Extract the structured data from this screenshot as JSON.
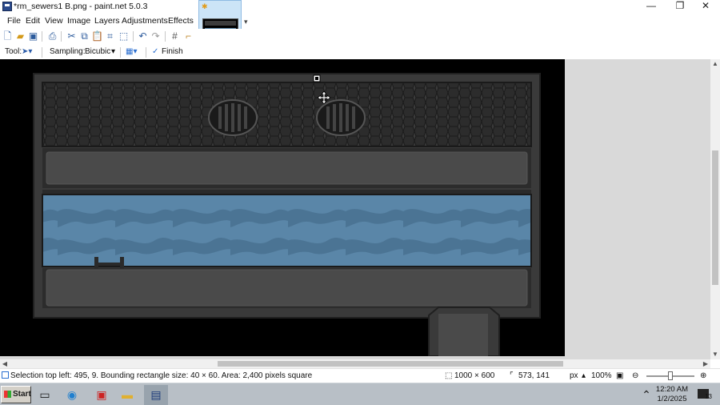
{
  "window": {
    "title": "*rm_sewers1 B.png - paint.net 5.0.3",
    "minimize": "—",
    "restore": "❐",
    "close": "✕"
  },
  "menu": {
    "items": [
      "File",
      "Edit",
      "View",
      "Image",
      "Layers",
      "Adjustments",
      "Effects"
    ]
  },
  "toolbar": {
    "icons": [
      "new-icon",
      "open-icon",
      "save-icon",
      "print-icon",
      "cut-icon",
      "copy-icon",
      "paste-icon",
      "crop-icon",
      "deselect-icon",
      "undo-icon",
      "redo-icon",
      "grid-icon",
      "ruler-icon"
    ]
  },
  "tool_options": {
    "tool_label": "Tool:",
    "sampling_label": "Sampling:",
    "sampling_value": "Bicubic",
    "finish_label": "Finish"
  },
  "status": {
    "selection_info": "Selection top left: 495, 9. Bounding rectangle size: 40 × 60. Area: 2,400 pixels square",
    "image_size": "1000 × 600",
    "cursor_pos": "573, 141",
    "units": "px",
    "zoom": "100%"
  },
  "taskbar": {
    "start_label": "Start",
    "time": "12:20 AM",
    "date": "1/2/2025",
    "notification_count": "13"
  },
  "colors": {
    "selection_accent": "#cce4f7",
    "water": "#5a86a8",
    "grate": "#3a3a3a",
    "floor": "#4a4a4a"
  }
}
